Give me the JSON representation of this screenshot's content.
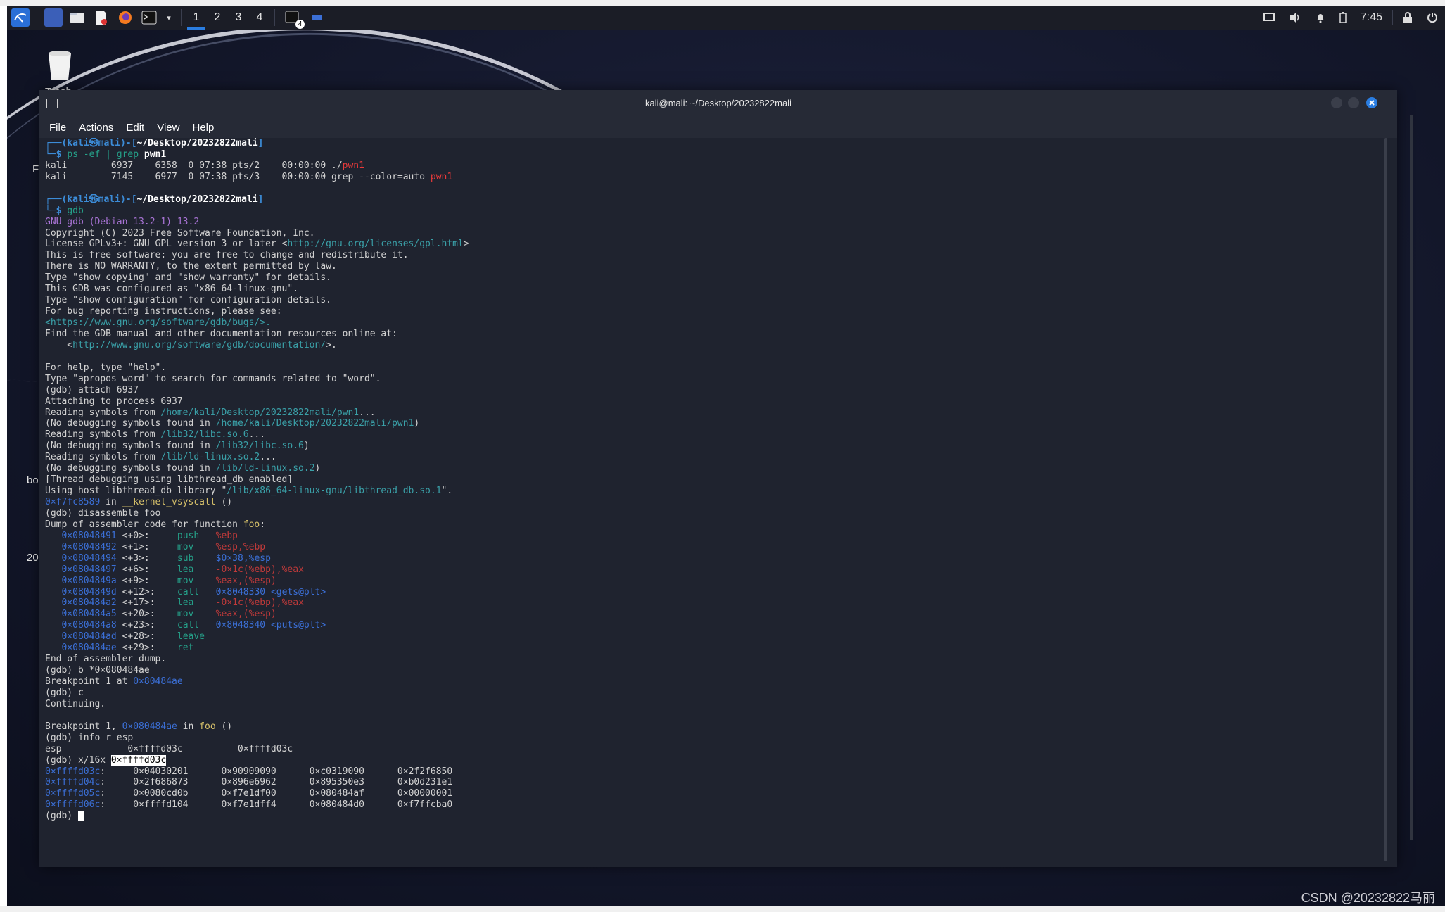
{
  "taskbar": {
    "workspaces": [
      "1",
      "2",
      "3",
      "4"
    ],
    "active_workspace": 0,
    "badge": "4",
    "clock": "7:45"
  },
  "desktop": {
    "icons": [
      {
        "label": "Trash"
      },
      {
        "label": "F"
      },
      {
        "label": "bo"
      },
      {
        "label": "20"
      }
    ]
  },
  "window": {
    "title": "kali@mali: ~/Desktop/20232822mali",
    "menu": [
      "File",
      "Actions",
      "Edit",
      "View",
      "Help"
    ]
  },
  "terminal": {
    "prompt1": {
      "user": "kali",
      "at": "㉿",
      "host": "mali",
      "path": "~/Desktop/20232822mali",
      "cmd": "ps -ef | grep",
      "arg": "pwn1"
    },
    "ps_rows": [
      {
        "pre": "kali        6937    6358  0 07:38 pts/2    00:00:00 ./",
        "hl": "pwn1"
      },
      {
        "pre": "kali        7145    6977  0 07:38 pts/3    00:00:00 grep --color=auto ",
        "hl": "pwn1"
      }
    ],
    "prompt2": {
      "user": "kali",
      "at": "㉿",
      "host": "mali",
      "path": "~/Desktop/20232822mali",
      "cmd": "gdb"
    },
    "gdb_banner": "GNU gdb (Debian 13.2-1) 13.2",
    "banner_lines": [
      "Copyright (C) 2023 Free Software Foundation, Inc.",
      "This is free software: you are free to change and redistribute it.",
      "There is NO WARRANTY, to the extent permitted by law.",
      "Type \"show copying\" and \"show warranty\" for details.",
      "This GDB was configured as \"x86_64-linux-gnu\".",
      "Type \"show configuration\" for configuration details.",
      "For bug reporting instructions, please see:"
    ],
    "license_pre": "License GPLv3+: GNU GPL version 3 or later <",
    "license_url": "http://gnu.org/licenses/gpl.html",
    "license_post": ">",
    "bugs_url": "<https://www.gnu.org/software/gdb/bugs/>.",
    "manual_line": "Find the GDB manual and other documentation resources online at:",
    "manual_url_pre": "    <",
    "manual_url": "http://www.gnu.org/software/gdb/documentation/",
    "manual_url_post": ">.",
    "help_line1": "For help, type \"help\".",
    "help_line2": "Type \"apropos word\" to search for commands related to \"word\".",
    "attach_cmd": "(gdb) attach 6937",
    "attaching": "Attaching to process 6937",
    "symbols": [
      {
        "pre": "Reading symbols from ",
        "path": "/home/kali/Desktop/20232822mali/pwn1",
        "post": "..."
      },
      {
        "pre": "(No debugging symbols found in ",
        "path": "/home/kali/Desktop/20232822mali/pwn1",
        "post": ")"
      },
      {
        "pre": "Reading symbols from ",
        "path": "/lib32/libc.so.6",
        "post": "..."
      },
      {
        "pre": "(No debugging symbols found in ",
        "path": "/lib32/libc.so.6",
        "post": ")"
      },
      {
        "pre": "Reading symbols from ",
        "path": "/lib/ld-linux.so.2",
        "post": "..."
      },
      {
        "pre": "(No debugging symbols found in ",
        "path": "/lib/ld-linux.so.2",
        "post": ")"
      }
    ],
    "thread_line": "[Thread debugging using libthread_db enabled]",
    "host_lib_pre": "Using host libthread_db library \"",
    "host_lib_path": "/lib/x86_64-linux-gnu/libthread_db.so.1",
    "host_lib_post": "\".",
    "vsyscall_addr": "0×f7fc8589",
    "vsyscall_in": " in ",
    "vsyscall_fn": "__kernel_vsyscall",
    "vsyscall_post": " ()",
    "disas_cmd": "(gdb) disassemble foo",
    "dump_pre": "Dump of assembler code for function ",
    "dump_fn": "foo",
    "dump_post": ":",
    "asm": [
      {
        "addr": "0×08048491",
        "off": " <+0>:",
        "op": "push",
        "args": "%ebp"
      },
      {
        "addr": "0×08048492",
        "off": " <+1>:",
        "op": "mov",
        "args": "%esp,%ebp"
      },
      {
        "addr": "0×08048494",
        "off": " <+3>:",
        "op": "sub",
        "args": "$0×38,%esp"
      },
      {
        "addr": "0×08048497",
        "off": " <+6>:",
        "op": "lea",
        "args": "-0×1c(%ebp),%eax"
      },
      {
        "addr": "0×0804849a",
        "off": " <+9>:",
        "op": "mov",
        "args": "%eax,(%esp)"
      },
      {
        "addr": "0×0804849d",
        "off": " <+12>:",
        "op": "call",
        "args": "0×8048330 <gets@plt>"
      },
      {
        "addr": "0×080484a2",
        "off": " <+17>:",
        "op": "lea",
        "args": "-0×1c(%ebp),%eax"
      },
      {
        "addr": "0×080484a5",
        "off": " <+20>:",
        "op": "mov",
        "args": "%eax,(%esp)"
      },
      {
        "addr": "0×080484a8",
        "off": " <+23>:",
        "op": "call",
        "args": "0×8048340 <puts@plt>"
      },
      {
        "addr": "0×080484ad",
        "off": " <+28>:",
        "op": "leave",
        "args": ""
      },
      {
        "addr": "0×080484ae",
        "off": " <+29>:",
        "op": "ret",
        "args": ""
      }
    ],
    "end_dump": "End of assembler dump.",
    "break_cmd": "(gdb) b *0×080484ae",
    "bp_pre": "Breakpoint 1 at ",
    "bp_addr": "0×80484ae",
    "cont_cmd": "(gdb) c",
    "continuing": "Continuing.",
    "bp_hit_pre": "Breakpoint 1, ",
    "bp_hit_addr": "0×080484ae",
    "bp_hit_in": " in ",
    "bp_hit_fn": "foo",
    "bp_hit_post": " ()",
    "info_cmd": "(gdb) info r esp",
    "esp_line": "esp            0×ffffd03c          0×ffffd03c",
    "x_cmd_pre": "(gdb) x/16x ",
    "x_cmd_hl": "0×ffffd03c",
    "mem": [
      {
        "addr": "0×ffffd03c",
        "vals": ":     0×04030201      0×90909090      0×c0319090      0×2f2f6850"
      },
      {
        "addr": "0×ffffd04c",
        "vals": ":     0×2f686873      0×896e6962      0×895350e3      0×b0d231e1"
      },
      {
        "addr": "0×ffffd05c",
        "vals": ":     0×0080cd0b      0×f7e1df00      0×080484af      0×00000001"
      },
      {
        "addr": "0×ffffd06c",
        "vals": ":     0×ffffd104      0×f7e1dff4      0×080484d0      0×f7ffcba0"
      }
    ],
    "final_prompt": "(gdb) "
  },
  "watermark": "CSDN @20232822马丽",
  "colors": {
    "terminal_bg": "#1f232f",
    "prompt_blue": "#3c8cd8",
    "highlight_red": "#e83a3a",
    "gdb_purple": "#a974d6",
    "path_teal": "#3aa0a8",
    "address_blue": "#3b6fd6",
    "func_yellow": "#d6c06a"
  }
}
